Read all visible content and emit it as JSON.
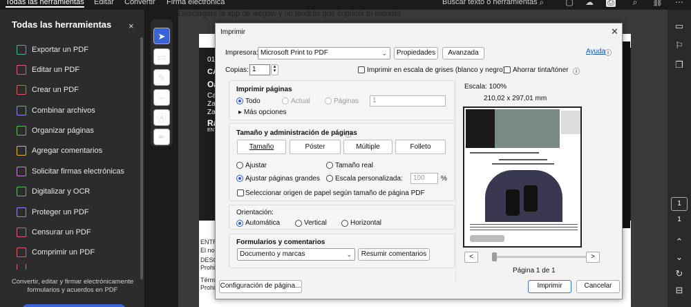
{
  "topbar": {
    "menus": [
      "Todas las herramientas",
      "Editar",
      "Convertir",
      "Firma electrónica"
    ],
    "search_label": "Buscar texto o herramientas"
  },
  "tools": {
    "title": "Todas las herramientas",
    "close_glyph": "×",
    "items": [
      {
        "label": "Exportar un PDF",
        "color": "#3fb6a8"
      },
      {
        "label": "Editar un PDF",
        "color": "#e0578a"
      },
      {
        "label": "Crear un PDF",
        "color": "#e25b5b"
      },
      {
        "label": "Combinar archivos",
        "color": "#8a8df0"
      },
      {
        "label": "Organizar páginas",
        "color": "#5fbf56"
      },
      {
        "label": "Agregar comentarios",
        "color": "#f0b43c"
      },
      {
        "label": "Solicitar firmas electrónicas",
        "color": "#c77de0"
      },
      {
        "label": "Digitalizar y OCR",
        "color": "#5fbf56"
      },
      {
        "label": "Proteger un PDF",
        "color": "#8a8df0"
      },
      {
        "label": "Censurar un PDF",
        "color": "#e0578a"
      },
      {
        "label": "Comprimir un PDF",
        "color": "#e25b5b"
      }
    ],
    "footer_text": "Convertir, editar y firmar electrónicamente formularios y acuerdos en PDF"
  },
  "document": {
    "text_lines_top": [
      "01",
      "CA",
      "Oa",
      "Ca",
      "Za",
      "Za",
      "Ra",
      "ENT"
    ],
    "text_lines_bottom": [
      "ENTR",
      "El no",
      "DESC",
      "Prohi",
      "Térm",
      "Prohi"
    ],
    "bottom_headline": "Descárgate la app de wegow y no tendrás que imprimir tu entrada"
  },
  "right_rail": {
    "page_box": "1",
    "page_num": "1"
  },
  "dialog": {
    "title": "Imprimir",
    "close_glyph": "✕",
    "printer_label": "Impresora:",
    "printer_value": "Microsoft Print to PDF",
    "properties_button": "Propiedades",
    "advanced_button": "Avanzada",
    "help_link": "Ayuda",
    "copies_label": "Copias:",
    "copies_value": "1",
    "grayscale_label": "Imprimir en escala de grises (blanco y negro)",
    "save_ink_label": "Ahorrar tinta/tóner",
    "pages_group": {
      "title": "Imprimir páginas",
      "all": "Todo",
      "current": "Actual",
      "pages": "Páginas",
      "pages_value": "1",
      "more_options": "Más opciones"
    },
    "size_group": {
      "title": "Tamaño y administración de páginas",
      "tabs": [
        "Tamaño",
        "Póster",
        "Múltiple",
        "Folleto"
      ],
      "fit": "Ajustar",
      "actual_size": "Tamaño real",
      "shrink_oversized": "Ajustar páginas grandes",
      "custom_scale": "Escala personalizada:",
      "custom_scale_value": "100",
      "percent": "%",
      "choose_source": "Seleccionar origen de papel según tamaño de página PDF"
    },
    "orientation_group": {
      "title": "Orientación:",
      "auto": "Automática",
      "vertical": "Vertical",
      "horizontal": "Horizontal"
    },
    "forms_group": {
      "title": "Formularios y comentarios",
      "select_value": "Documento y marcas",
      "summarize_button": "Resumir comentarios"
    },
    "preview": {
      "scale": "Escala: 100%",
      "size": "210,02 x 297,01 mm",
      "prev": "<",
      "next": ">",
      "page_of": "Página 1 de 1"
    },
    "page_setup_button": "Configuración de página...",
    "print_button": "Imprimir",
    "cancel_button": "Cancelar"
  }
}
